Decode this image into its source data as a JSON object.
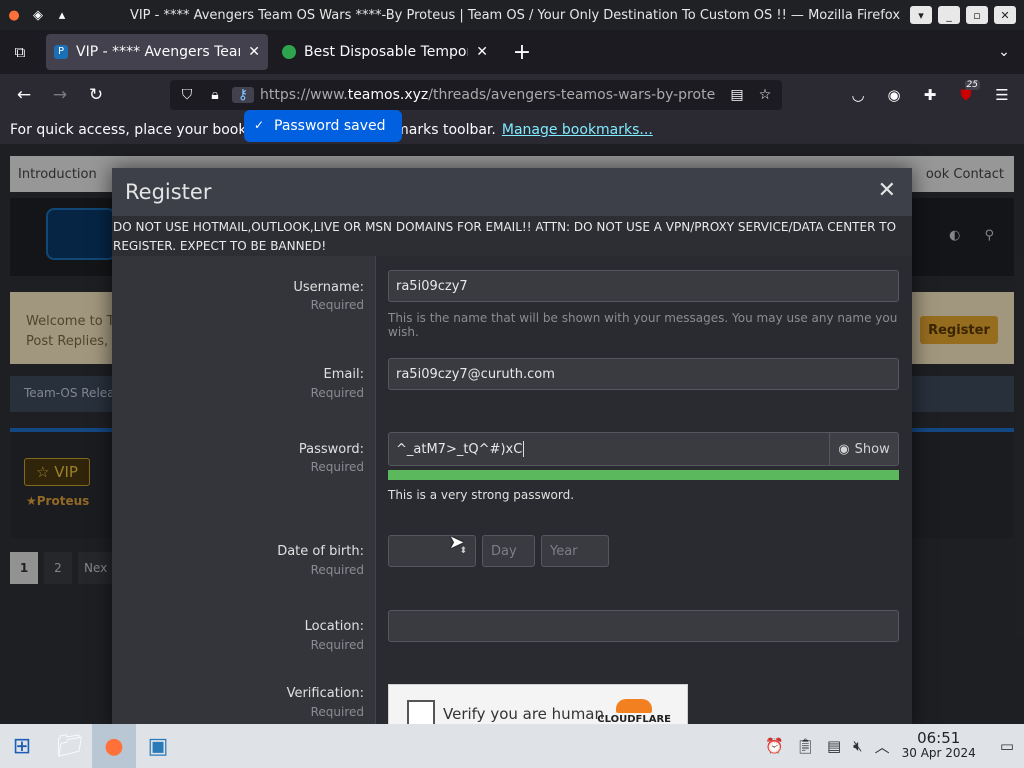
{
  "window": {
    "title": "VIP - **** Avengers Team OS Wars ****-By Proteus | Team OS / Your Only Destination To Custom OS !! — Mozilla Firefox",
    "controls": [
      "▾",
      "_",
      "▫",
      "✕"
    ]
  },
  "tabs": [
    {
      "label": "VIP - **** Avengers Team",
      "active": true,
      "fav_color": "#1b6fb5"
    },
    {
      "label": "Best Disposable Tempora",
      "active": false,
      "fav_color": "#2ea44f"
    }
  ],
  "nav": {
    "url_prefix": "https://www.",
    "url_domain": "teamos.xyz",
    "url_rest": "/threads/avengers-teamos-wars-by-prote",
    "extension_badge": "25"
  },
  "bookmarks_bar": {
    "text": "For quick access, place your bookm",
    "text_tail": "marks toolbar.",
    "link": "Manage bookmarks..."
  },
  "toast": {
    "text": "Password saved"
  },
  "site": {
    "nav_left": "Introduction",
    "nav_right": "ook Contact",
    "welcome_l1": "Welcome to Te",
    "welcome_l2": "Post Replies, U",
    "register_button": "Register",
    "breadcrumb": "Team-OS Relea",
    "vip_label": "VIP",
    "author": "Proteus",
    "pager": [
      "1",
      "2",
      "Nex"
    ]
  },
  "modal": {
    "title": "Register",
    "notice": "DO NOT USE HOTMAIL,OUTLOOK,LIVE OR MSN DOMAINS FOR EMAIL!! ATTN: DO NOT USE A VPN/PROXY SERVICE/DATA CENTER TO REGISTER. EXPECT TO BE BANNED!",
    "required": "Required",
    "username": {
      "label": "Username:",
      "value": "ra5i09czy7",
      "hint": "This is the name that will be shown with your messages. You may use any name you wish."
    },
    "email": {
      "label": "Email:",
      "value": "ra5i09czy7@curuth.com"
    },
    "password": {
      "label": "Password:",
      "value": "^_atM7>_tQ^#)xC",
      "show_label": "Show",
      "strength_text": "This is a very strong password.",
      "strength": 1.0
    },
    "dob": {
      "label": "Date of birth:",
      "month": "",
      "day_placeholder": "Day",
      "year_placeholder": "Year"
    },
    "location": {
      "label": "Location:",
      "value": ""
    },
    "verification": {
      "label": "Verification:",
      "captcha_text": "Verify you are human",
      "provider": "CLOUDFLARE"
    }
  },
  "taskbar": {
    "time": "06:51",
    "date": "30 Apr 2024"
  }
}
